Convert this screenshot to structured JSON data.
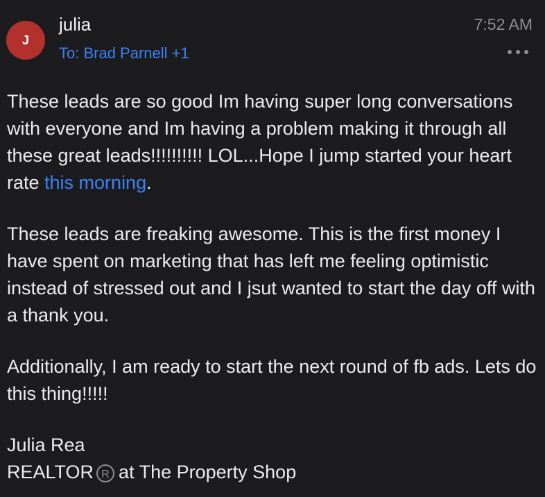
{
  "header": {
    "avatar_initial": "J",
    "sender": "julia",
    "recipients": "To: Brad Parnell +1",
    "time": "7:52 AM",
    "more_icon": "ellipsis-icon"
  },
  "message": {
    "p1_text": "These leads are so good Im having super long conversations with everyone and Im having a problem making it through all these great leads!!!!!!!!!! LOL...Hope I jump started your heart rate ",
    "p1_link": "this morning",
    "p1_end": ".",
    "p2": "These leads are freaking awesome. This is the first money I have spent on marketing that has left me feeling optimistic instead of stressed out and I jsut wanted to start the day off with a thank you.",
    "p3": "Additionally, I am ready to start the next round of fb ads. Lets do this thing!!!!!",
    "signature_name": "Julia Rea",
    "signature_title_pre": "REALTOR",
    "signature_reg_mark": "R",
    "signature_title_post": "at The Property Shop"
  },
  "colors": {
    "background": "#1c1c1e",
    "avatar": "#b3312c",
    "link": "#3b82f6"
  }
}
